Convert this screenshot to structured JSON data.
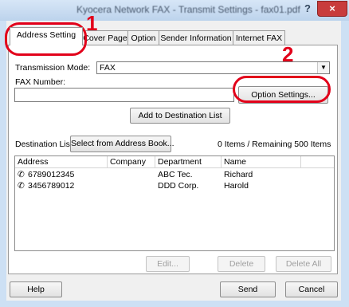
{
  "window": {
    "title": "Kyocera Network FAX - Transmit Settings - fax01.pdf",
    "help_glyph": "?",
    "close_glyph": "×"
  },
  "tabs": [
    {
      "label": "Address Setting"
    },
    {
      "label": "Cover Page"
    },
    {
      "label": "Option"
    },
    {
      "label": "Sender Information"
    },
    {
      "label": "Internet FAX"
    }
  ],
  "form": {
    "transmission_mode_label": "Transmission Mode:",
    "transmission_mode_value": "FAX",
    "fax_number_label": "FAX Number:",
    "fax_number_value": "",
    "option_settings_label": "Option Settings...",
    "add_to_destination_label": "Add to Destination List"
  },
  "destination": {
    "label": "Destination List:",
    "select_button": "Select from Address Book...",
    "count_text": "0 Items / Remaining 500 Items",
    "columns": [
      "Address",
      "Company",
      "Department",
      "Name"
    ],
    "rows": [
      {
        "address": "6789012345",
        "company": "",
        "department": "ABC Tec.",
        "name": "Richard"
      },
      {
        "address": "3456789012",
        "company": "",
        "department": "DDD Corp.",
        "name": "Harold"
      }
    ],
    "edit_label": "Edit...",
    "delete_label": "Delete",
    "delete_all_label": "Delete All"
  },
  "footer": {
    "help_label": "Help",
    "send_label": "Send",
    "cancel_label": "Cancel"
  },
  "callouts": {
    "one": "1",
    "two": "2",
    "color": "#e2001a"
  }
}
